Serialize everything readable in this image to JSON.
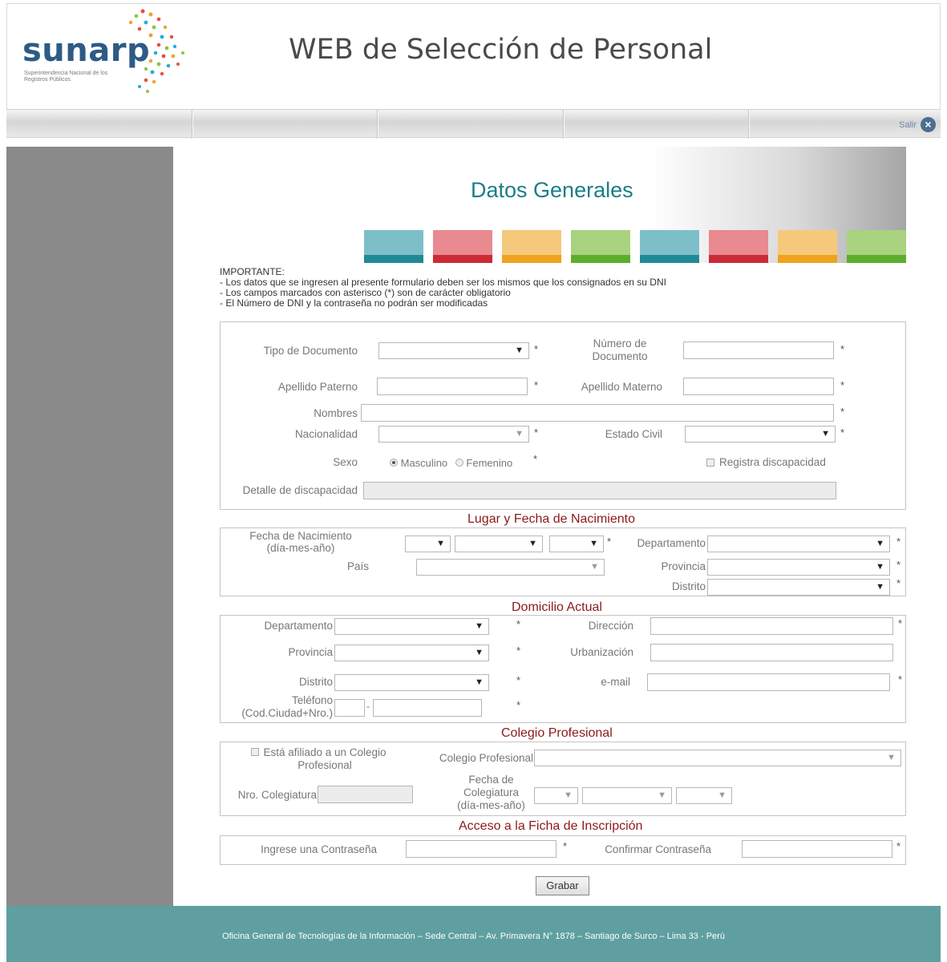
{
  "header": {
    "logo_text": "sunarp",
    "logo_subtitle": "Superintendencia Nacional de los Registros Públicos",
    "site_title": "WEB de Selección de Personal"
  },
  "nav": {
    "exit_label": "Salir",
    "exit_icon": "close-circle-icon"
  },
  "banner": {
    "title": "Datos Generales",
    "color_blocks": [
      {
        "top": "#7dbfc9",
        "bottom": "#1f8a96"
      },
      {
        "top": "#e88a90",
        "bottom": "#cc2a36"
      },
      {
        "top": "#f5c97b",
        "bottom": "#efa21d"
      },
      {
        "top": "#a9d27f",
        "bottom": "#5cad2c"
      },
      {
        "top": "#7dbfc9",
        "bottom": "#1f8a96"
      },
      {
        "top": "#e88a90",
        "bottom": "#cc2a36"
      },
      {
        "top": "#f5c97b",
        "bottom": "#efa21d"
      },
      {
        "top": "#a9d27f",
        "bottom": "#5cad2c"
      }
    ]
  },
  "notes": [
    "IMPORTANTE:",
    "- Los datos que se ingresen al presente formulario deben ser los mismos que los consignados en su DNI",
    "- Los campos marcados con asterisco (*) son de carácter obligatorio",
    "- El Número de DNI y la contraseña no podrán ser modificadas"
  ],
  "general": {
    "tipo_documento": "Tipo de Documento",
    "numero_documento_1": "Número de",
    "numero_documento_2": "Documento",
    "apellido_paterno": "Apellido Paterno",
    "apellido_materno": "Apellido Materno",
    "nombres": "Nombres",
    "nacionalidad": "Nacionalidad",
    "estado_civil": "Estado Civil",
    "sexo": "Sexo",
    "masculino": "Masculino",
    "femenino": "Femenino",
    "discapacidad_check": "Registra discapacidad",
    "detalle_discapacidad": "Detalle de discapacidad",
    "required": "*"
  },
  "nacimiento": {
    "title": "Lugar y Fecha de Nacimiento",
    "fecha_1": "Fecha de Nacimiento",
    "fecha_2": "(día-mes-año)",
    "pais": "País",
    "departamento": "Departamento",
    "provincia": "Provincia",
    "distrito": "Distrito"
  },
  "domicilio": {
    "title": "Domicilio Actual",
    "departamento": "Departamento",
    "provincia": "Provincia",
    "distrito": "Distrito",
    "telefono_1": "Teléfono",
    "telefono_2": "(Cod.Ciudad+Nro.)",
    "direccion": "Dirección",
    "urbanizacion": "Urbanización",
    "email": "e-mail"
  },
  "colegio": {
    "title": "Colegio Profesional",
    "afiliado_1": "Está afiliado a un Colegio",
    "afiliado_2": "Profesional",
    "colegio_label": "Colegio Profesional",
    "nro_colegiatura": "Nro. Colegiatura",
    "fecha_1": "Fecha de",
    "fecha_2": "Colegiatura",
    "fecha_3": "(día-mes-año)"
  },
  "acceso": {
    "title": "Acceso a la Ficha de Inscripción",
    "password": "Ingrese una Contraseña",
    "confirm": "Confirmar Contraseña"
  },
  "actions": {
    "grabar": "Grabar"
  },
  "footer": {
    "text": "Oficina General de Tecnologías de la Información – Sede Central – Av. Primavera N° 1878 – Santiago de Surco – Lima 33 - Perú"
  },
  "dropdown_glyph": "▼"
}
